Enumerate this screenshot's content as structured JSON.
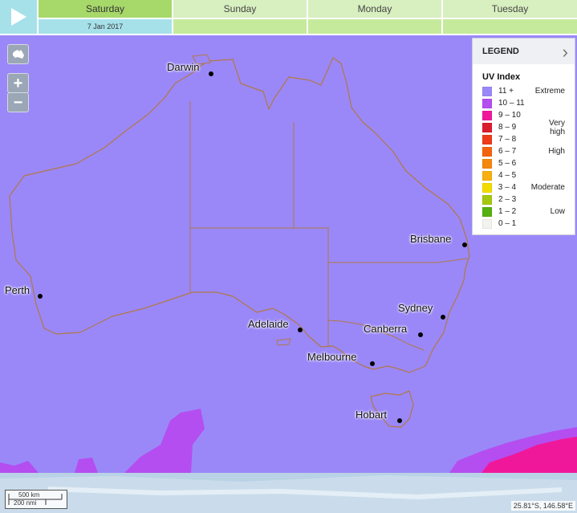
{
  "timeline": {
    "days": [
      {
        "label": "Saturday",
        "active": true
      },
      {
        "label": "Sunday",
        "active": false
      },
      {
        "label": "Monday",
        "active": false
      },
      {
        "label": "Tuesday",
        "active": false
      }
    ],
    "selected_date": "7 Jan 2017"
  },
  "map": {
    "cities": [
      {
        "id": "darwin",
        "name": "Darwin"
      },
      {
        "id": "brisbane",
        "name": "Brisbane"
      },
      {
        "id": "perth",
        "name": "Perth"
      },
      {
        "id": "sydney",
        "name": "Sydney"
      },
      {
        "id": "adelaide",
        "name": "Adelaide"
      },
      {
        "id": "canberra",
        "name": "Canberra"
      },
      {
        "id": "melbourne",
        "name": "Melbourne"
      },
      {
        "id": "hobart",
        "name": "Hobart"
      }
    ],
    "zoom_in": "+",
    "zoom_out": "−",
    "scale_km": "500 km",
    "scale_nmi": "200 nmi",
    "cursor_coords": "25.81°S, 146.58°E"
  },
  "legend": {
    "header": "LEGEND",
    "title": "UV Index",
    "rows": [
      {
        "range": "11 +",
        "category": "Extreme",
        "color": "#9a88f8"
      },
      {
        "range": "10 – 11",
        "category": "",
        "color": "#b44ef0"
      },
      {
        "range": "9 – 10",
        "category": "",
        "color": "#f0189a"
      },
      {
        "range": "8 – 9",
        "category": "Very high",
        "color": "#dc1c2c"
      },
      {
        "range": "7 – 8",
        "category": "",
        "color": "#ee3a18"
      },
      {
        "range": "6 – 7",
        "category": "High",
        "color": "#f4620e"
      },
      {
        "range": "5 – 6",
        "category": "",
        "color": "#f4880e"
      },
      {
        "range": "4 – 5",
        "category": "",
        "color": "#f6b010"
      },
      {
        "range": "3 – 4",
        "category": "Moderate",
        "color": "#f2dc00"
      },
      {
        "range": "2 – 3",
        "category": "",
        "color": "#a4c80e"
      },
      {
        "range": "1 – 2",
        "category": "Low",
        "color": "#56b010"
      },
      {
        "range": "0 – 1",
        "category": "",
        "color": "#f2f2ee"
      }
    ]
  }
}
